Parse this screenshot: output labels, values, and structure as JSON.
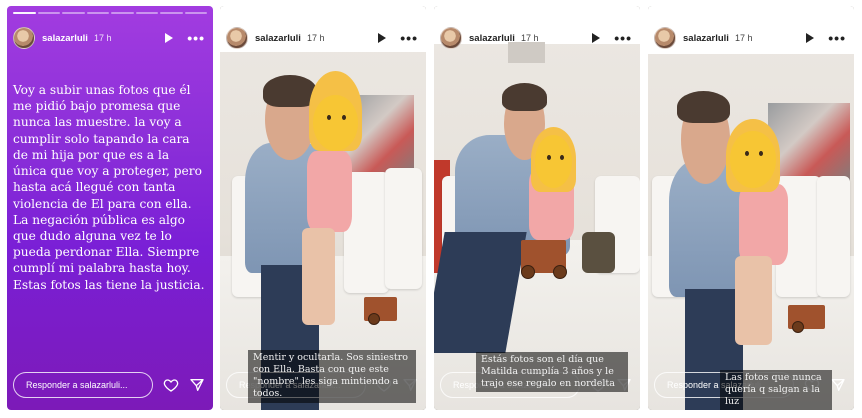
{
  "stories": [
    {
      "username": "salazarluli",
      "time": "17 h",
      "text": "Voy a subir unas fotos que él me pidió bajo promesa que nunca las muestre. la voy a cumplir solo tapando la cara de mi hija por que es a la única que voy a proteger, pero hasta acá llegué con tanta violencia de El para con ella. La negación pública es algo que dudo alguna vez te lo pueda perdonar Ella. Siempre cumplí mi palabra hasta hoy. Estas fotos las tiene la justicia.",
      "reply_placeholder": "Responder a salazarluli..."
    },
    {
      "username": "salazarluli",
      "time": "17 h",
      "caption": "Mentir y ocultarla. Sos siniestro con Ella. Basta con que este \"nombre\" les siga mintiendo a todos.",
      "reply_placeholder": "Responder a salazarluli..."
    },
    {
      "username": "salazarluli",
      "time": "17 h",
      "caption": "Estás fotos son el día que Matilda cumplía 3 años y le trajo ese regalo en nordelta",
      "reply_placeholder": "Responder a salazarluli..."
    },
    {
      "username": "salazarluli",
      "time": "17 h",
      "caption": "Las fotos que nunca quería q salgan a la luz",
      "reply_placeholder": "Responder a salazarluli..."
    }
  ],
  "icons": {
    "play": "play-icon",
    "more": "more-options-icon",
    "like": "heart-icon",
    "share": "send-icon"
  },
  "colors": {
    "story1_gradient_top": "#a23ce0",
    "story1_gradient_bottom": "#7c1ab8",
    "reply_border": "#ffffff"
  }
}
